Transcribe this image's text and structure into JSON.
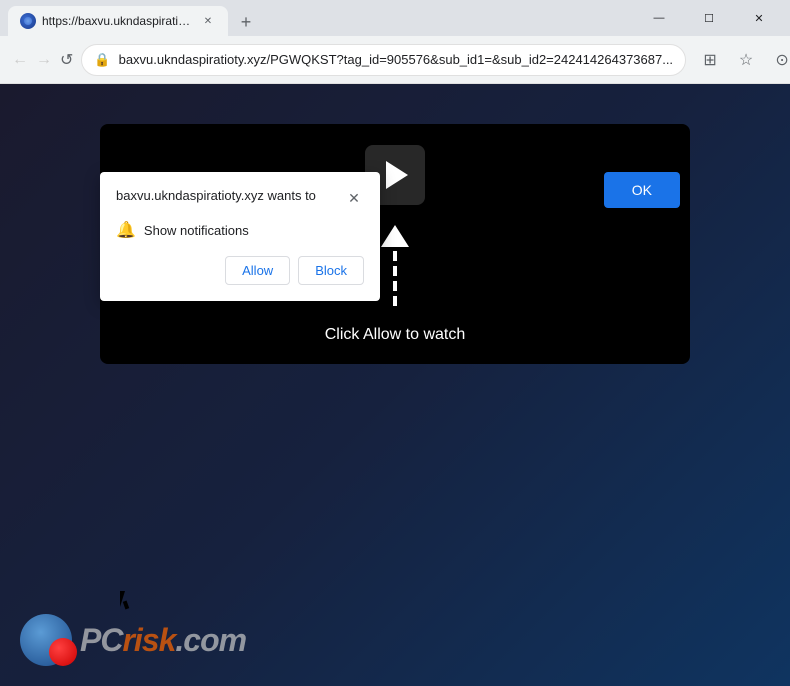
{
  "browser": {
    "tab": {
      "title": "https://baxvu.ukndaspiratioty.xyz...",
      "favicon_alt": "site-favicon"
    },
    "new_tab_label": "+",
    "window_controls": {
      "minimize": "—",
      "maximize": "☐",
      "close": "✕"
    },
    "nav": {
      "back_label": "←",
      "forward_label": "→",
      "reload_label": "↺",
      "url": "baxvu.ukndaspiratioty.xyz/PGWQKST?tag_id=905576&sub_id1=&sub_id2=242414264373687...",
      "extensions_label": "⊞",
      "bookmark_label": "☆",
      "profile_label": "⊙",
      "menu_label": "⋮"
    }
  },
  "dialog": {
    "title": "baxvu.ukndaspiratioty.xyz wants to",
    "close_label": "✕",
    "notification_label": "Show notifications",
    "allow_label": "Allow",
    "block_label": "Block"
  },
  "page": {
    "ok_label": "OK",
    "click_allow_text": "Click Allow to watch"
  },
  "watermark": {
    "text_pc": "PC",
    "text_risk": "risk",
    "text_com": ".com"
  }
}
